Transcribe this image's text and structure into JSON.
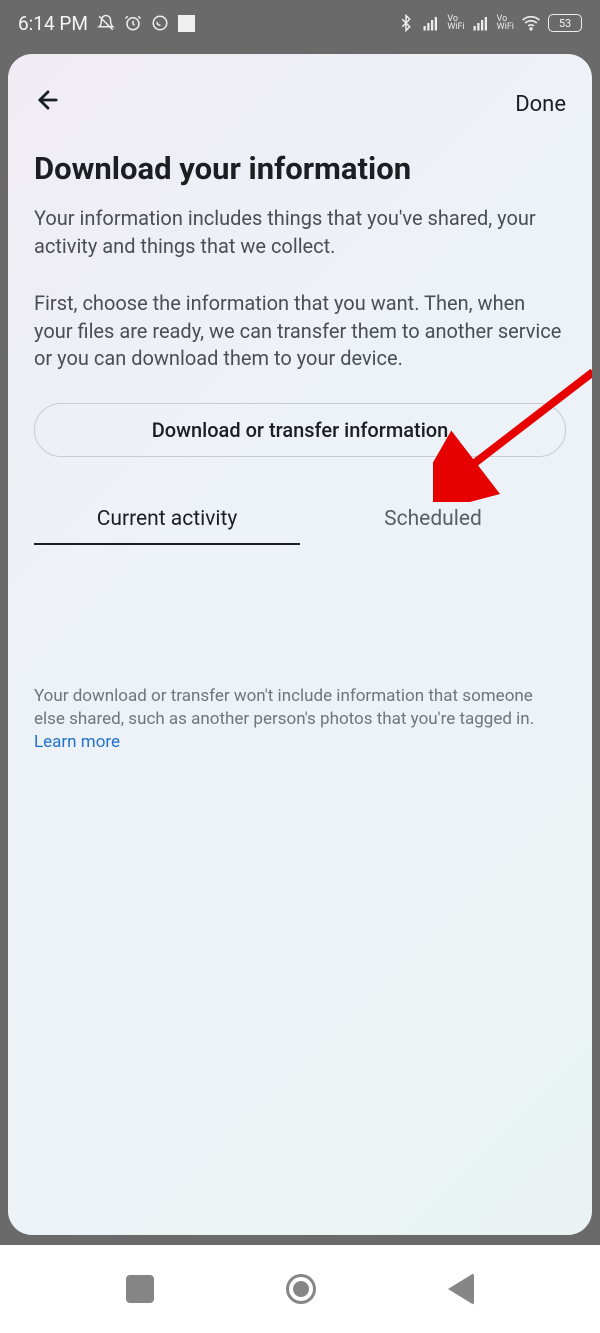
{
  "status_bar": {
    "time": "6:14 PM",
    "battery_percent": "53",
    "vo_label_top": "Vo",
    "vo_label_bottom": "WiFi"
  },
  "header": {
    "done_label": "Done"
  },
  "page_title": "Download your information",
  "description_1": "Your information includes things that you've shared, your activity and things that we collect.",
  "description_2": "First, choose the information that you want. Then, when your files are ready, we can transfer them to another service or you can download them to your device.",
  "main_button_label": "Download or transfer information",
  "tabs": {
    "current_activity": "Current activity",
    "scheduled": "Scheduled"
  },
  "disclaimer_main": "Your download or transfer won't include information that someone else shared, such as another person's photos that you're tagged in. ",
  "disclaimer_link": "Learn more"
}
